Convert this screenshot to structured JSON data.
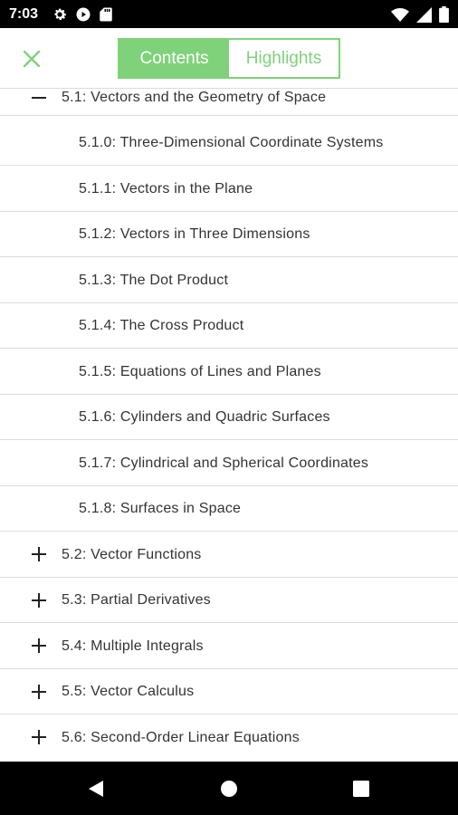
{
  "status_bar": {
    "time": "7:03",
    "left_icons": [
      "gear-icon",
      "play-icon",
      "sd-card-icon"
    ],
    "right_icons": [
      "wifi-icon",
      "signal-icon",
      "battery-icon"
    ]
  },
  "toolbar": {
    "close_icon": "close-icon",
    "tabs": [
      {
        "label": "Contents",
        "active": true
      },
      {
        "label": "Highlights",
        "active": false
      }
    ],
    "accent_color": "#7fd27a"
  },
  "toc": {
    "expanded_section": {
      "label": "5.1: Vectors and the Geometry of Space",
      "toggle_icon": "minus-icon"
    },
    "subsections": [
      {
        "label": "5.1.0: Three-Dimensional Coordinate Systems"
      },
      {
        "label": "5.1.1: Vectors in the Plane"
      },
      {
        "label": "5.1.2: Vectors in Three Dimensions"
      },
      {
        "label": "5.1.3: The Dot Product"
      },
      {
        "label": "5.1.4: The Cross Product"
      },
      {
        "label": "5.1.5: Equations of Lines and Planes"
      },
      {
        "label": "5.1.6: Cylinders and Quadric Surfaces"
      },
      {
        "label": "5.1.7: Cylindrical and Spherical Coordinates"
      },
      {
        "label": "5.1.8: Surfaces in Space"
      }
    ],
    "collapsed_sections": [
      {
        "label": "5.2: Vector Functions",
        "toggle_icon": "plus-icon"
      },
      {
        "label": "5.3: Partial Derivatives",
        "toggle_icon": "plus-icon"
      },
      {
        "label": "5.4: Multiple Integrals",
        "toggle_icon": "plus-icon"
      },
      {
        "label": "5.5: Vector Calculus",
        "toggle_icon": "plus-icon"
      },
      {
        "label": "5.6: Second-Order Linear Equations",
        "toggle_icon": "plus-icon"
      }
    ]
  },
  "nav_bar": {
    "buttons": [
      "back-icon",
      "home-icon",
      "recents-icon"
    ]
  }
}
